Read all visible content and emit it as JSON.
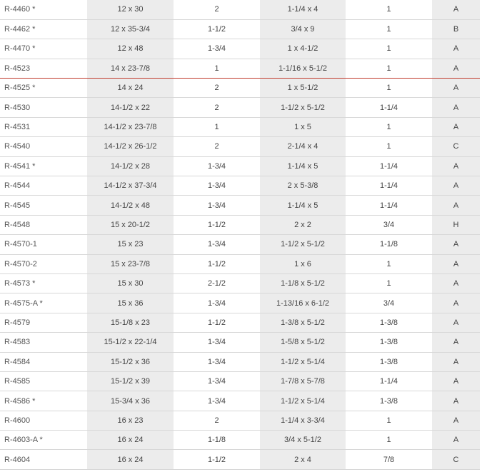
{
  "rows": [
    [
      "R-4460 *",
      "12 x 30",
      "2",
      "1-1/4 x 4",
      "1",
      "A"
    ],
    [
      "R-4462 *",
      "12 x 35-3/4",
      "1-1/2",
      "3/4 x 9",
      "1",
      "B"
    ],
    [
      "R-4470 *",
      "12 x 48",
      "1-3/4",
      "1 x 4-1/2",
      "1",
      "A"
    ],
    [
      "R-4523",
      "14 x 23-7/8",
      "1",
      "1-1/16 x 5-1/2",
      "1",
      "A"
    ],
    [
      "R-4525 *",
      "14 x 24",
      "2",
      "1 x 5-1/2",
      "1",
      "A"
    ],
    [
      "R-4530",
      "14-1/2 x 22",
      "2",
      "1-1/2 x 5-1/2",
      "1-1/4",
      "A"
    ],
    [
      "R-4531",
      "14-1/2 x 23-7/8",
      "1",
      "1 x 5",
      "1",
      "A"
    ],
    [
      "R-4540",
      "14-1/2 x 26-1/2",
      "2",
      "2-1/4 x 4",
      "1",
      "C"
    ],
    [
      "R-4541 *",
      "14-1/2 x 28",
      "1-3/4",
      "1-1/4 x 5",
      "1-1/4",
      "A"
    ],
    [
      "R-4544",
      "14-1/2 x 37-3/4",
      "1-3/4",
      "2 x 5-3/8",
      "1-1/4",
      "A"
    ],
    [
      "R-4545",
      "14-1/2 x 48",
      "1-3/4",
      "1-1/4 x 5",
      "1-1/4",
      "A"
    ],
    [
      "R-4548",
      "15 x 20-1/2",
      "1-1/2",
      "2 x 2",
      "3/4",
      "H"
    ],
    [
      "R-4570-1",
      "15 x 23",
      "1-3/4",
      "1-1/2 x 5-1/2",
      "1-1/8",
      "A"
    ],
    [
      "R-4570-2",
      "15 x 23-7/8",
      "1-1/2",
      "1 x 6",
      "1",
      "A"
    ],
    [
      "R-4573 *",
      "15 x 30",
      "2-1/2",
      "1-1/8 x 5-1/2",
      "1",
      "A"
    ],
    [
      "R-4575-A *",
      "15 x 36",
      "1-3/4",
      "1-13/16 x 6-1/2",
      "3/4",
      "A"
    ],
    [
      "R-4579",
      "15-1/8 x 23",
      "1-1/2",
      "1-3/8 x 5-1/2",
      "1-3/8",
      "A"
    ],
    [
      "R-4583",
      "15-1/2 x 22-1/4",
      "1-3/4",
      "1-5/8 x 5-1/2",
      "1-3/8",
      "A"
    ],
    [
      "R-4584",
      "15-1/2 x 36",
      "1-3/4",
      "1-1/2 x 5-1/4",
      "1-3/8",
      "A"
    ],
    [
      "R-4585",
      "15-1/2 x 39",
      "1-3/4",
      "1-7/8 x 5-7/8",
      "1-1/4",
      "A"
    ],
    [
      "R-4586 *",
      "15-3/4 x 36",
      "1-3/4",
      "1-1/2 x 5-1/4",
      "1-3/8",
      "A"
    ],
    [
      "R-4600",
      "16 x 23",
      "2",
      "1-1/4 x 3-3/4",
      "1",
      "A"
    ],
    [
      "R-4603-A *",
      "16 x 24",
      "1-1/8",
      "3/4 x 5-1/2",
      "1",
      "A"
    ],
    [
      "R-4604",
      "16 x 24",
      "1-1/2",
      "2 x 4",
      "7/8",
      "C"
    ]
  ]
}
